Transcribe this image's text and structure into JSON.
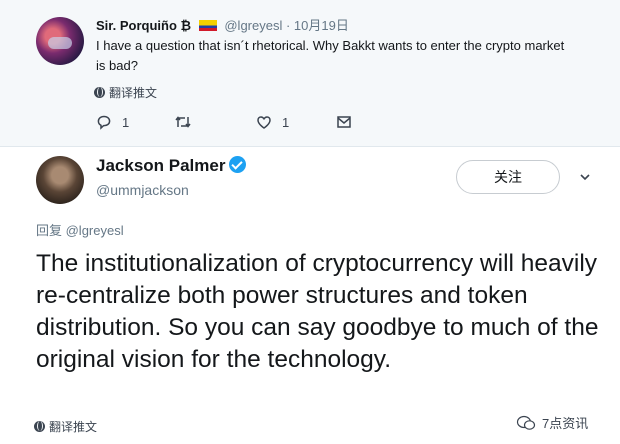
{
  "reply": {
    "author_name": "Sir. Porquiño ₿",
    "handle": "@lgreyesl",
    "date": "· 10月19日",
    "text": "I have a question that isn´t rhetorical. Why Bakkt wants to enter the crypto market is bad?",
    "translate_label": "翻译推文",
    "reply_count": "1",
    "like_count": "1"
  },
  "tweet": {
    "author_name": "Jackson Palmer",
    "handle": "@ummjackson",
    "follow_label": "关注",
    "reply_to": "回复 @lgreyesl",
    "text": "The institutionalization of cryptocurrency will heavily re-centralize both power structures and token distribution. So you can say goodbye to much of the original vision for the technology.",
    "translate_label": "翻译推文"
  },
  "watermark": {
    "text": "7点资讯"
  },
  "colors": {
    "verified": "#1da1f2",
    "muted": "#657786",
    "reply_bg": "#f5f8fa"
  },
  "icons": [
    "globe-icon",
    "reply-icon",
    "retweet-icon",
    "like-icon",
    "message-icon",
    "verified-icon",
    "chevron-down-icon",
    "wechat-icon"
  ]
}
